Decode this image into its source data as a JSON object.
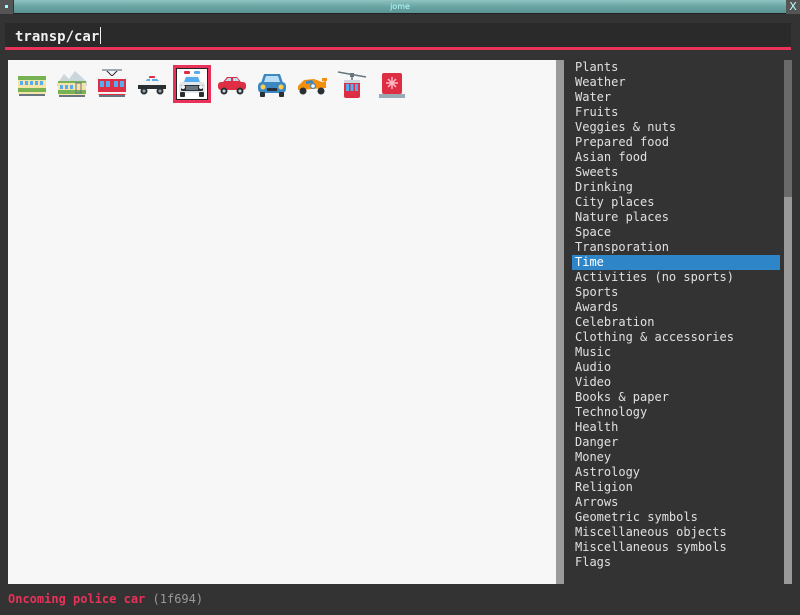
{
  "window": {
    "title": "jome",
    "close_label": "X"
  },
  "search": {
    "value": "transp/car"
  },
  "emojis": [
    {
      "name": "Railway car",
      "icon": "railway-car-icon"
    },
    {
      "name": "Mountain railway",
      "icon": "mountain-railway-icon"
    },
    {
      "name": "Tram car",
      "icon": "tram-car-icon"
    },
    {
      "name": "Police car",
      "icon": "police-car-icon"
    },
    {
      "name": "Oncoming police car",
      "icon": "oncoming-police-car-icon",
      "selected": true
    },
    {
      "name": "Automobile",
      "icon": "automobile-icon"
    },
    {
      "name": "Oncoming automobile",
      "icon": "oncoming-automobile-icon"
    },
    {
      "name": "Racing car",
      "icon": "racing-car-icon"
    },
    {
      "name": "Aerial tramway",
      "icon": "aerial-tramway-icon"
    },
    {
      "name": "Police car light",
      "icon": "police-car-light-icon"
    }
  ],
  "categories": [
    "Plants",
    "Weather",
    "Water",
    "Fruits",
    "Veggies & nuts",
    "Prepared food",
    "Asian food",
    "Sweets",
    "Drinking",
    "City places",
    "Nature places",
    "Space",
    "Transporation",
    "Time",
    "Activities (no sports)",
    "Sports",
    "Awards",
    "Celebration",
    "Clothing & accessories",
    "Music",
    "Audio",
    "Video",
    "Books & paper",
    "Technology",
    "Health",
    "Danger",
    "Money",
    "Astrology",
    "Religion",
    "Arrows",
    "Geometric symbols",
    "Miscellaneous objects",
    "Miscellaneous symbols",
    "Flags"
  ],
  "active_category": "Time",
  "status": {
    "name": "Oncoming police car",
    "codepoint": "(1f694)"
  },
  "colors": {
    "accent": "#e8325a",
    "selection": "#2e86c8",
    "background": "#333333"
  }
}
